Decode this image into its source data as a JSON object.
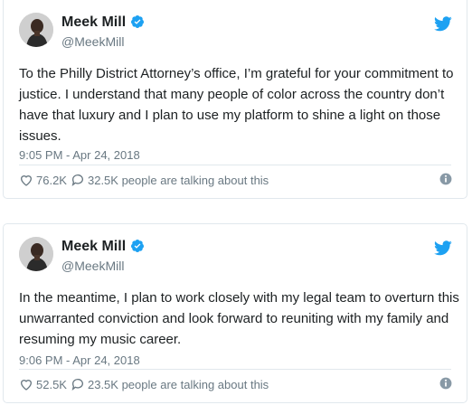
{
  "tweets": [
    {
      "name": "Meek Mill",
      "handle": "@MeekMill",
      "text": "To the Philly District Attorney’s office, I’m grateful for your commitment to justice. I understand that many people of color across the country don’t have that luxury and I plan to use my platform to shine a light on those issues.",
      "timestamp": "9:05 PM - Apr 24, 2018",
      "likes": "76.2K",
      "talking": "32.5K people are talking about this"
    },
    {
      "name": "Meek Mill",
      "handle": "@MeekMill",
      "text": "In the meantime, I plan to work closely with my legal team to overturn this unwarranted conviction and look forward to reuniting with my family and resuming my music career.",
      "timestamp": "9:06 PM - Apr 24, 2018",
      "likes": "52.5K",
      "talking": "23.5K people are talking about this"
    }
  ],
  "icons": {
    "verified": "verified-badge-icon",
    "bird": "twitter-bird-icon",
    "heart": "heart-icon",
    "reply": "reply-bubble-icon",
    "info": "info-icon"
  },
  "colors": {
    "twitter_blue": "#1da1f2",
    "muted": "#697882",
    "text": "#1c2022",
    "border": "#e1e8ed"
  }
}
